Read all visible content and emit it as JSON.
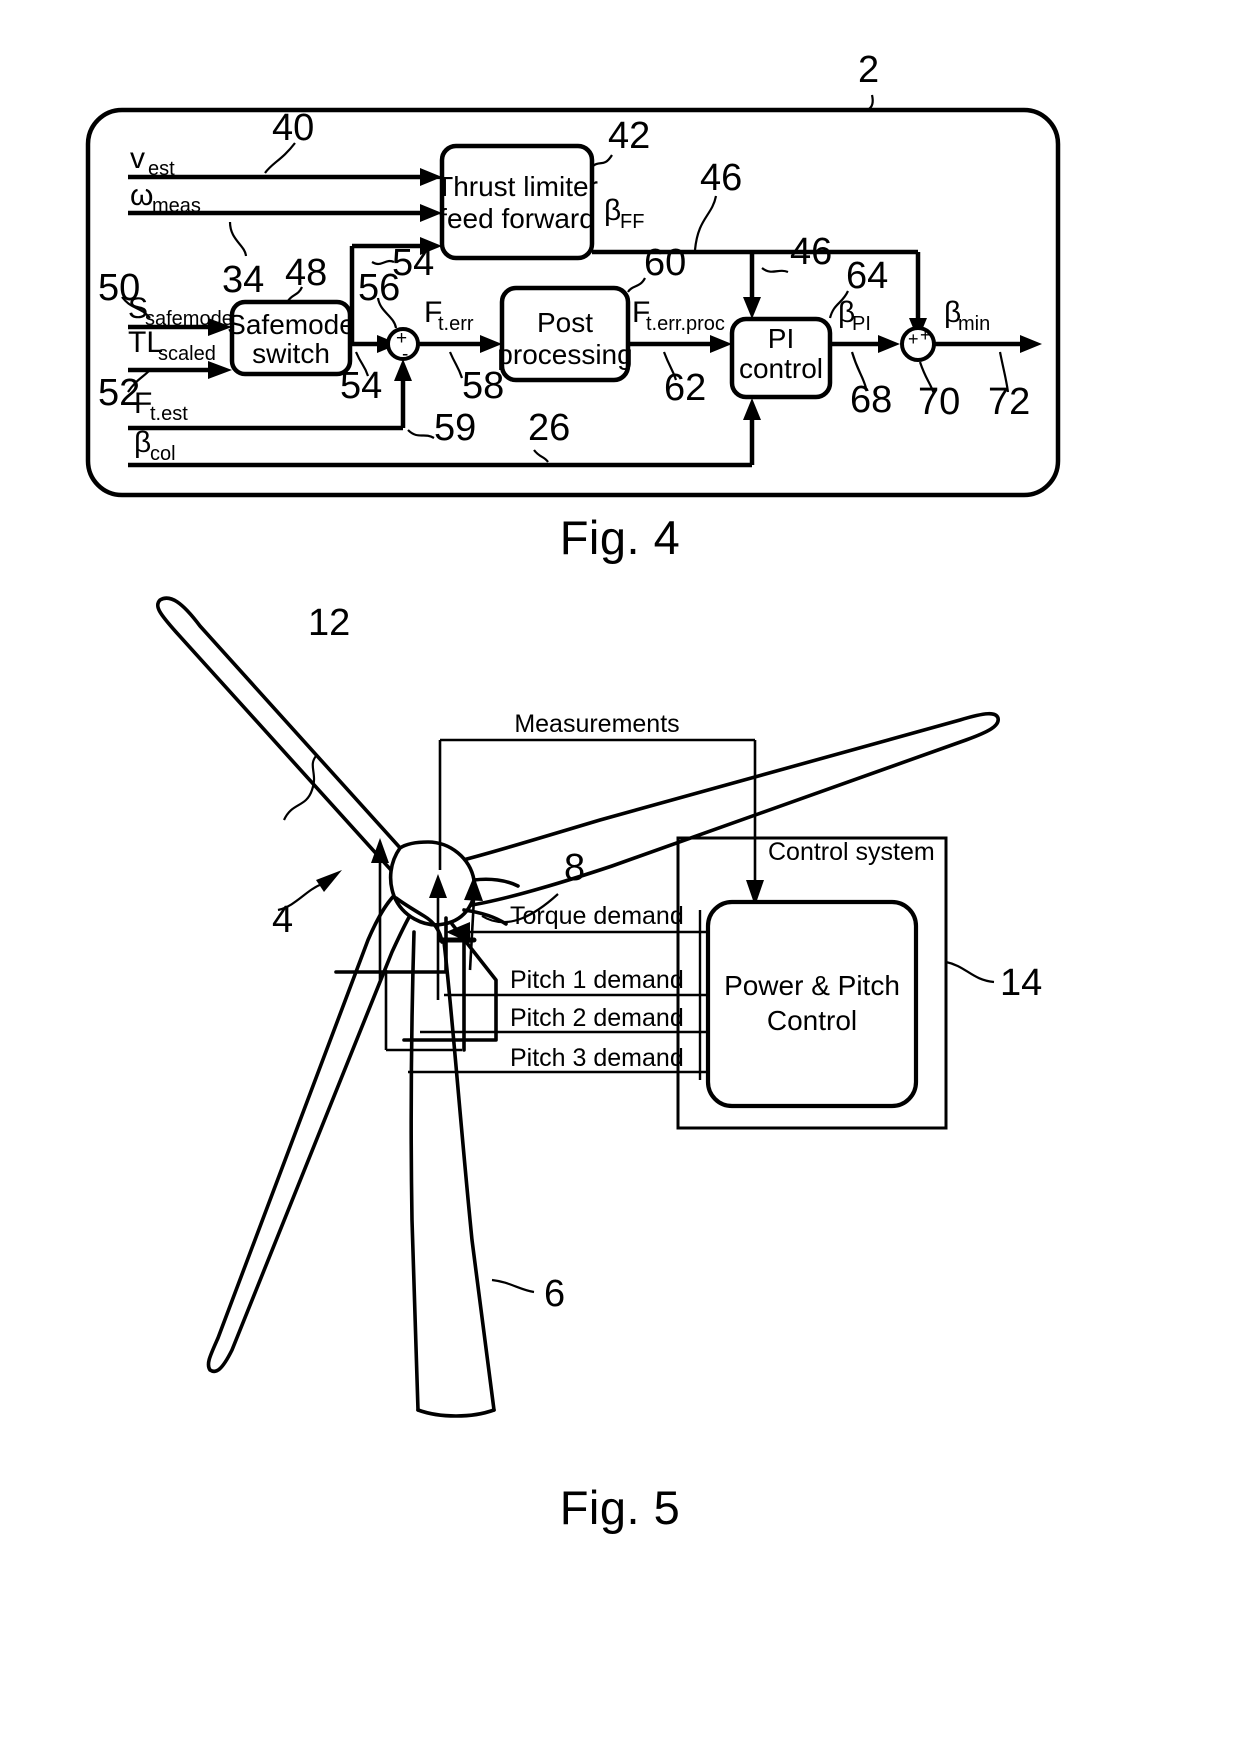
{
  "figures": [
    {
      "id": "fig4",
      "caption": "Fig. 4",
      "outer_ref": "2",
      "blocks": [
        {
          "id": "thrust-limiter",
          "lines": [
            "Thrust limiter",
            "feed forward"
          ],
          "ref": "42"
        },
        {
          "id": "safemode-switch",
          "lines": [
            "Safemode",
            "switch"
          ],
          "ref": "48"
        },
        {
          "id": "post-processing",
          "lines": [
            "Post",
            "processing"
          ],
          "ref": "60"
        },
        {
          "id": "pi-control",
          "lines": [
            "PI",
            "control"
          ],
          "ref": "64"
        }
      ],
      "inputs": [
        {
          "id": "v-est",
          "base": "v",
          "sub": "est",
          "ref": "40"
        },
        {
          "id": "omega-meas",
          "base": "ω",
          "sub": "meas",
          "ref": "34"
        },
        {
          "id": "s-safemode",
          "base": "S",
          "sub": "safemode",
          "ref": "50"
        },
        {
          "id": "tl-scaled",
          "base": "TL",
          "sub": "scaled",
          "ref": "52"
        },
        {
          "id": "ft-est",
          "base": "F",
          "sub": "t.est",
          "ref": "59"
        },
        {
          "id": "beta-col",
          "base": "β",
          "sub": "col",
          "ref": "26"
        }
      ],
      "signals": [
        {
          "id": "beta-ff",
          "base": "β",
          "sub": "FF",
          "ref": "46"
        },
        {
          "id": "ft-err",
          "base": "F",
          "sub": "t.err",
          "ref": "58"
        },
        {
          "id": "ft-err-proc",
          "base": "F",
          "sub": "t.err.proc",
          "ref": "62"
        },
        {
          "id": "beta-pi",
          "base": "β",
          "sub": "PI",
          "ref": "68"
        },
        {
          "id": "beta-min",
          "base": "β",
          "sub": "min",
          "ref": "72"
        }
      ],
      "ref_numbers": [
        "2",
        "40",
        "42",
        "46",
        "46",
        "34",
        "48",
        "50",
        "52",
        "54",
        "54",
        "56",
        "58",
        "59",
        "60",
        "62",
        "64",
        "68",
        "70",
        "72",
        "26"
      ],
      "junctions": [
        {
          "id": "summing-junction-56",
          "ref": "56",
          "signs": [
            "+",
            "-"
          ]
        },
        {
          "id": "summing-junction-70",
          "ref": "70",
          "signs": [
            "+",
            "+"
          ]
        }
      ]
    },
    {
      "id": "fig5",
      "caption": "Fig. 5",
      "turbine_refs": [
        {
          "id": "rotor-blade",
          "ref": "12"
        },
        {
          "id": "wind-turbine",
          "ref": "4"
        },
        {
          "id": "tower",
          "ref": "6"
        },
        {
          "id": "nacelle-rotor",
          "ref": "8"
        },
        {
          "id": "control-system-box",
          "ref": "14"
        }
      ],
      "labels": {
        "measurements": "Measurements",
        "control_system": "Control system",
        "torque_demand": "Torque demand",
        "pitch1_demand": "Pitch 1 demand",
        "pitch2_demand": "Pitch 2 demand",
        "pitch3_demand": "Pitch 3 demand",
        "power_pitch_control": [
          "Power & Pitch",
          "Control"
        ]
      }
    }
  ],
  "colors": {
    "ink": "#000000",
    "paper": "#ffffff"
  }
}
